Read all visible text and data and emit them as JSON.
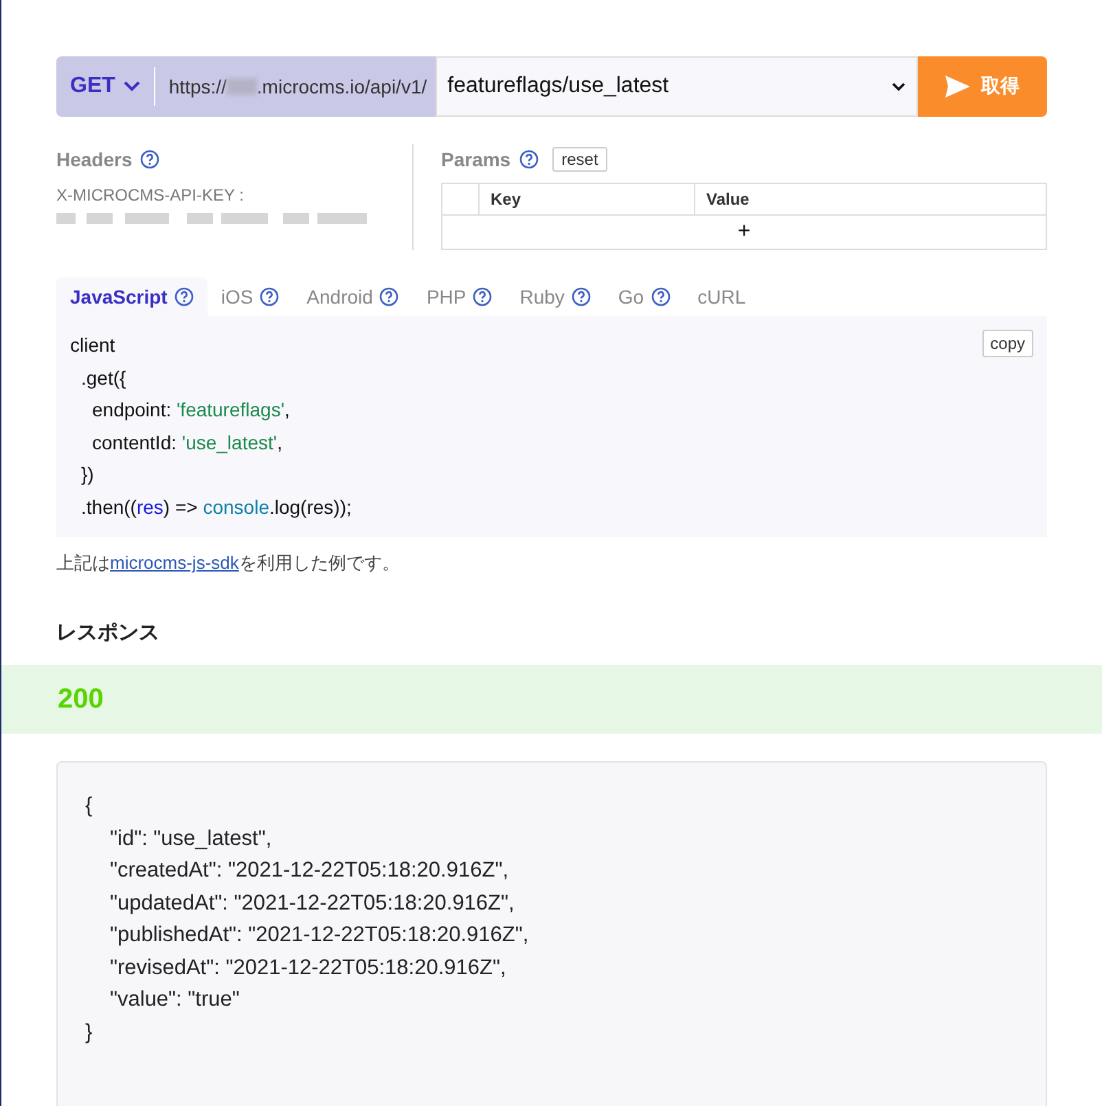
{
  "request": {
    "method": "GET",
    "base_url_prefix": "https://",
    "base_url_suffix": ".microcms.io/api/v1/",
    "endpoint": "featureflags/use_latest",
    "send_label": "取得"
  },
  "headers": {
    "title": "Headers",
    "key_label": "X-MICROCMS-API-KEY :"
  },
  "params": {
    "title": "Params",
    "reset_label": "reset",
    "columns": [
      "Key",
      "Value"
    ],
    "add_label": "+"
  },
  "tabs": [
    {
      "label": "JavaScript",
      "help": true,
      "selected": true
    },
    {
      "label": "iOS",
      "help": true,
      "selected": false
    },
    {
      "label": "Android",
      "help": true,
      "selected": false
    },
    {
      "label": "PHP",
      "help": true,
      "selected": false
    },
    {
      "label": "Ruby",
      "help": true,
      "selected": false
    },
    {
      "label": "Go",
      "help": true,
      "selected": false
    },
    {
      "label": "cURL",
      "help": false,
      "selected": false
    }
  ],
  "code": {
    "copy_label": "copy",
    "lines": [
      {
        "tokens": [
          {
            "kind": "plain",
            "text": "client"
          }
        ],
        "children": [
          {
            "tokens": [
              {
                "kind": "plain",
                "text": ".get({"
              }
            ],
            "children": [
              {
                "tokens": [
                  {
                    "kind": "plain",
                    "text": "endpoint: "
                  },
                  {
                    "kind": "string",
                    "text": "'featureflags'"
                  },
                  {
                    "kind": "plain",
                    "text": ","
                  }
                ]
              },
              {
                "tokens": [
                  {
                    "kind": "plain",
                    "text": "contentId: "
                  },
                  {
                    "kind": "string",
                    "text": "'use_latest'"
                  },
                  {
                    "kind": "plain",
                    "text": ","
                  }
                ]
              }
            ]
          },
          {
            "tokens": [
              {
                "kind": "plain",
                "text": "})"
              }
            ]
          },
          {
            "tokens": [
              {
                "kind": "plain",
                "text": ".then(("
              },
              {
                "kind": "param",
                "text": "res"
              },
              {
                "kind": "plain",
                "text": ") => "
              },
              {
                "kind": "builtin",
                "text": "console"
              },
              {
                "kind": "plain",
                "text": ".log(res));"
              }
            ]
          }
        ]
      }
    ]
  },
  "note": {
    "before": "上記は",
    "link": "microcms-js-sdk",
    "after": "を利用した例です。"
  },
  "response": {
    "title": "レスポンス",
    "status": "200",
    "open": "{",
    "entries": [
      "\"id\": \"use_latest\",",
      "\"createdAt\": \"2021-12-22T05:18:20.916Z\",",
      "\"updatedAt\": \"2021-12-22T05:18:20.916Z\",",
      "\"publishedAt\": \"2021-12-22T05:18:20.916Z\",",
      "\"revisedAt\": \"2021-12-22T05:18:20.916Z\",",
      "\"value\": \"true\""
    ],
    "close": "}"
  }
}
